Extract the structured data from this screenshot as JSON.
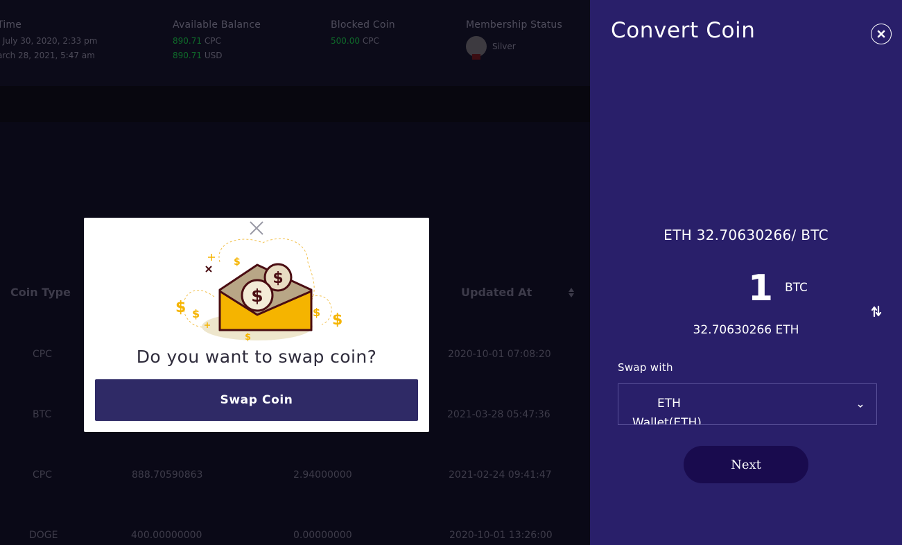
{
  "background": {
    "info": {
      "time_label": "Time",
      "time_lines": [
        ": July 30, 2020, 2:33 pm",
        "arch 28, 2021, 5:47 am"
      ],
      "balance_label": "Available Balance",
      "balance_lines": [
        {
          "value": "890.71",
          "unit": "CPC"
        },
        {
          "value": "890.71",
          "unit": "USD"
        }
      ],
      "blocked_label": "Blocked Coin",
      "blocked": {
        "value": "500.00",
        "unit": "CPC"
      },
      "membership_label": "Membership Status",
      "membership_value": "Silver"
    },
    "table": {
      "headers": {
        "coin_type": "Coin Type",
        "updated_at": "Updated At"
      },
      "rows": [
        {
          "coin": "CPC",
          "col2": "",
          "col3": "",
          "updated": "2020-10-01 07:08:20"
        },
        {
          "coin": "BTC",
          "col2": "",
          "col3": "",
          "updated": "2021-03-28 05:47:36"
        },
        {
          "coin": "CPC",
          "col2": "888.70590863",
          "col3": "2.94000000",
          "updated": "2021-02-24 09:41:47"
        },
        {
          "coin": "DOGE",
          "col2": "400.00000000",
          "col3": "0.00000000",
          "updated": "2020-10-01 13:26:00"
        }
      ]
    }
  },
  "modal": {
    "title": "Do you want to swap coin?",
    "button": "Swap Coin",
    "illustration_icon": "money-envelope-icon"
  },
  "panel": {
    "title": "Convert Coin",
    "rate": "ETH  32.70630266/ BTC",
    "amount": "1",
    "amount_unit": "BTC",
    "converted": "32.70630266 ETH",
    "swap_label": "Swap with",
    "select": {
      "line1": "ETH",
      "line2": "Wallet(ETH)"
    },
    "next_button": "Next"
  },
  "colors": {
    "panel_bg": "#291f6a",
    "modal_button": "#2f2a66",
    "next_button": "#190b4e",
    "gold": "#f5b400",
    "dark_brown": "#4a0d12",
    "balance_green": "#0f6b2a"
  }
}
